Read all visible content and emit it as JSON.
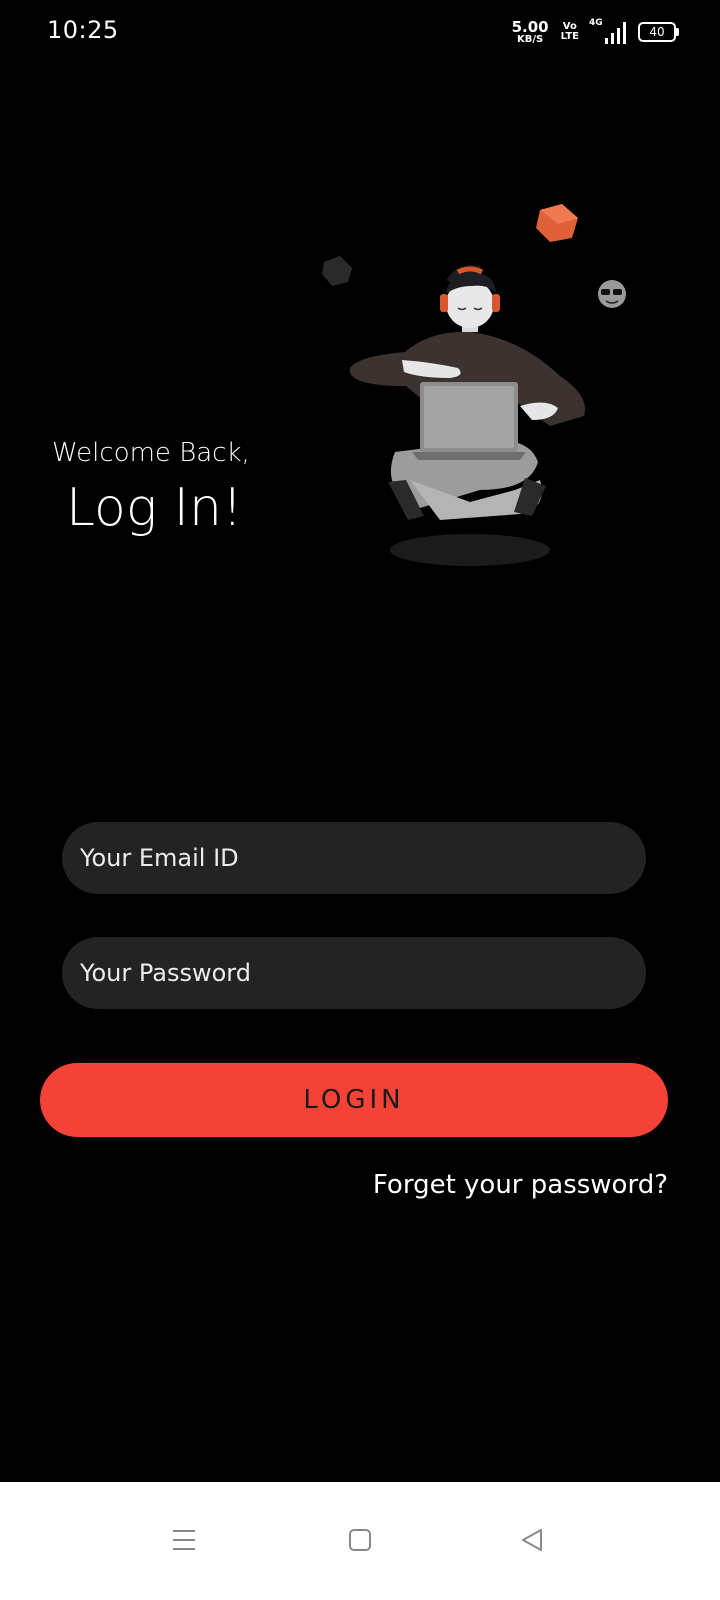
{
  "status_bar": {
    "time": "10:25",
    "net_speed_value": "5.00",
    "net_speed_unit": "KB/S",
    "volte_top": "Vo",
    "volte_bottom": "LTE",
    "network_type": "4G",
    "battery": "40"
  },
  "welcome": {
    "subtitle": "Welcome Back,",
    "title": "Log In!"
  },
  "form": {
    "email_placeholder": "Your Email ID",
    "password_placeholder": "Your Password",
    "login_label": "LOGIN",
    "forgot_label": "Forget your password?"
  },
  "colors": {
    "background": "#000000",
    "input_bg": "#232323",
    "accent": "#f44236",
    "nav_bar_bg": "#ffffff"
  },
  "icons": {
    "illustration": "man-with-laptop-illustration",
    "nav_menu": "menu-icon",
    "nav_home": "home-square-icon",
    "nav_back": "back-triangle-icon"
  }
}
